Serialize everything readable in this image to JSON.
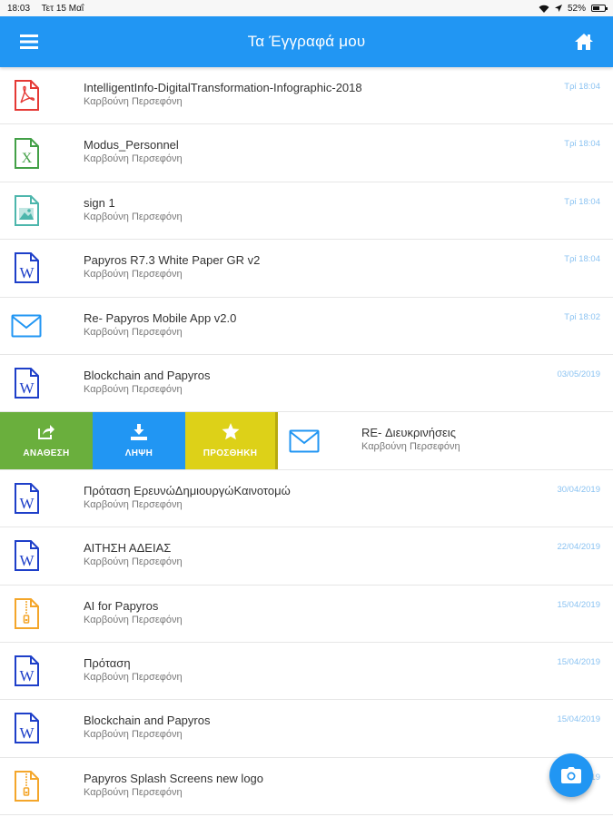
{
  "status_bar": {
    "time": "18:03",
    "date": "Τετ 15 Μαΐ",
    "battery": "52%",
    "battery_level": 0.52
  },
  "app_bar": {
    "title": "Τα Έγγραφά μου",
    "menu_icon": "hamburger-menu-icon",
    "home_icon": "home-icon"
  },
  "colors": {
    "primary": "#2196f3",
    "assign": "#6aaf3d",
    "favorite": "#ddd118",
    "pdf": "#e53935",
    "excel": "#43a047",
    "image": "#4db6ac",
    "word": "#1e3fc9",
    "email": "#2196f3",
    "zip": "#f4a62a",
    "date": "#8bc3f2"
  },
  "documents": [
    {
      "title": "IntelligentInfo-DigitalTransformation-Infographic-2018",
      "owner": "Καρβούνη Περσεφόνη",
      "date": "Τρί 18:04",
      "type": "pdf"
    },
    {
      "title": "Modus_Personnel",
      "owner": "Καρβούνη Περσεφόνη",
      "date": "Τρί 18:04",
      "type": "excel"
    },
    {
      "title": "sign 1",
      "owner": "Καρβούνη Περσεφόνη",
      "date": "Τρί 18:04",
      "type": "image"
    },
    {
      "title": "Papyros R7.3 White Paper GR v2",
      "owner": "Καρβούνη Περσεφόνη",
      "date": "Τρί 18:04",
      "type": "word"
    },
    {
      "title": "Re- Papyros Mobile App v2.0",
      "owner": "Καρβούνη Περσεφόνη",
      "date": "Τρί 18:02",
      "type": "email"
    },
    {
      "title": "Blockchain and Papyros",
      "owner": "Καρβούνη Περσεφόνη",
      "date": "03/05/2019",
      "type": "word"
    },
    {
      "title": "RE- Διευκρινήσεις",
      "owner": "Καρβούνη Περσεφόνη",
      "date": "",
      "type": "email",
      "swiped": true
    },
    {
      "title": "Πρόταση ΕρευνώΔημιουργώΚαινοτομώ",
      "owner": "Καρβούνη Περσεφόνη",
      "date": "30/04/2019",
      "type": "word"
    },
    {
      "title": "ΑΙΤΗΣΗ ΑΔΕΙΑΣ",
      "owner": "Καρβούνη Περσεφόνη",
      "date": "22/04/2019",
      "type": "word"
    },
    {
      "title": "AI for Papyros",
      "owner": "Καρβούνη Περσεφόνη",
      "date": "15/04/2019",
      "type": "zip"
    },
    {
      "title": "Πρόταση",
      "owner": "Καρβούνη Περσεφόνη",
      "date": "15/04/2019",
      "type": "word"
    },
    {
      "title": "Blockchain and Papyros",
      "owner": "Καρβούνη Περσεφόνη",
      "date": "15/04/2019",
      "type": "word"
    },
    {
      "title": "Papyros Splash Screens new logo",
      "owner": "Καρβούνη Περσεφόνη",
      "date": "15/04/2019",
      "type": "zip"
    }
  ],
  "swipe_actions": [
    {
      "label": "ΑΝΑΘΕΣΗ",
      "icon": "share-icon"
    },
    {
      "label": "ΛΗΨΗ",
      "icon": "download-icon"
    },
    {
      "label": "ΠΡΟΣΘΗΚΗ",
      "icon": "star-icon"
    }
  ],
  "fab": {
    "icon": "camera-icon"
  }
}
